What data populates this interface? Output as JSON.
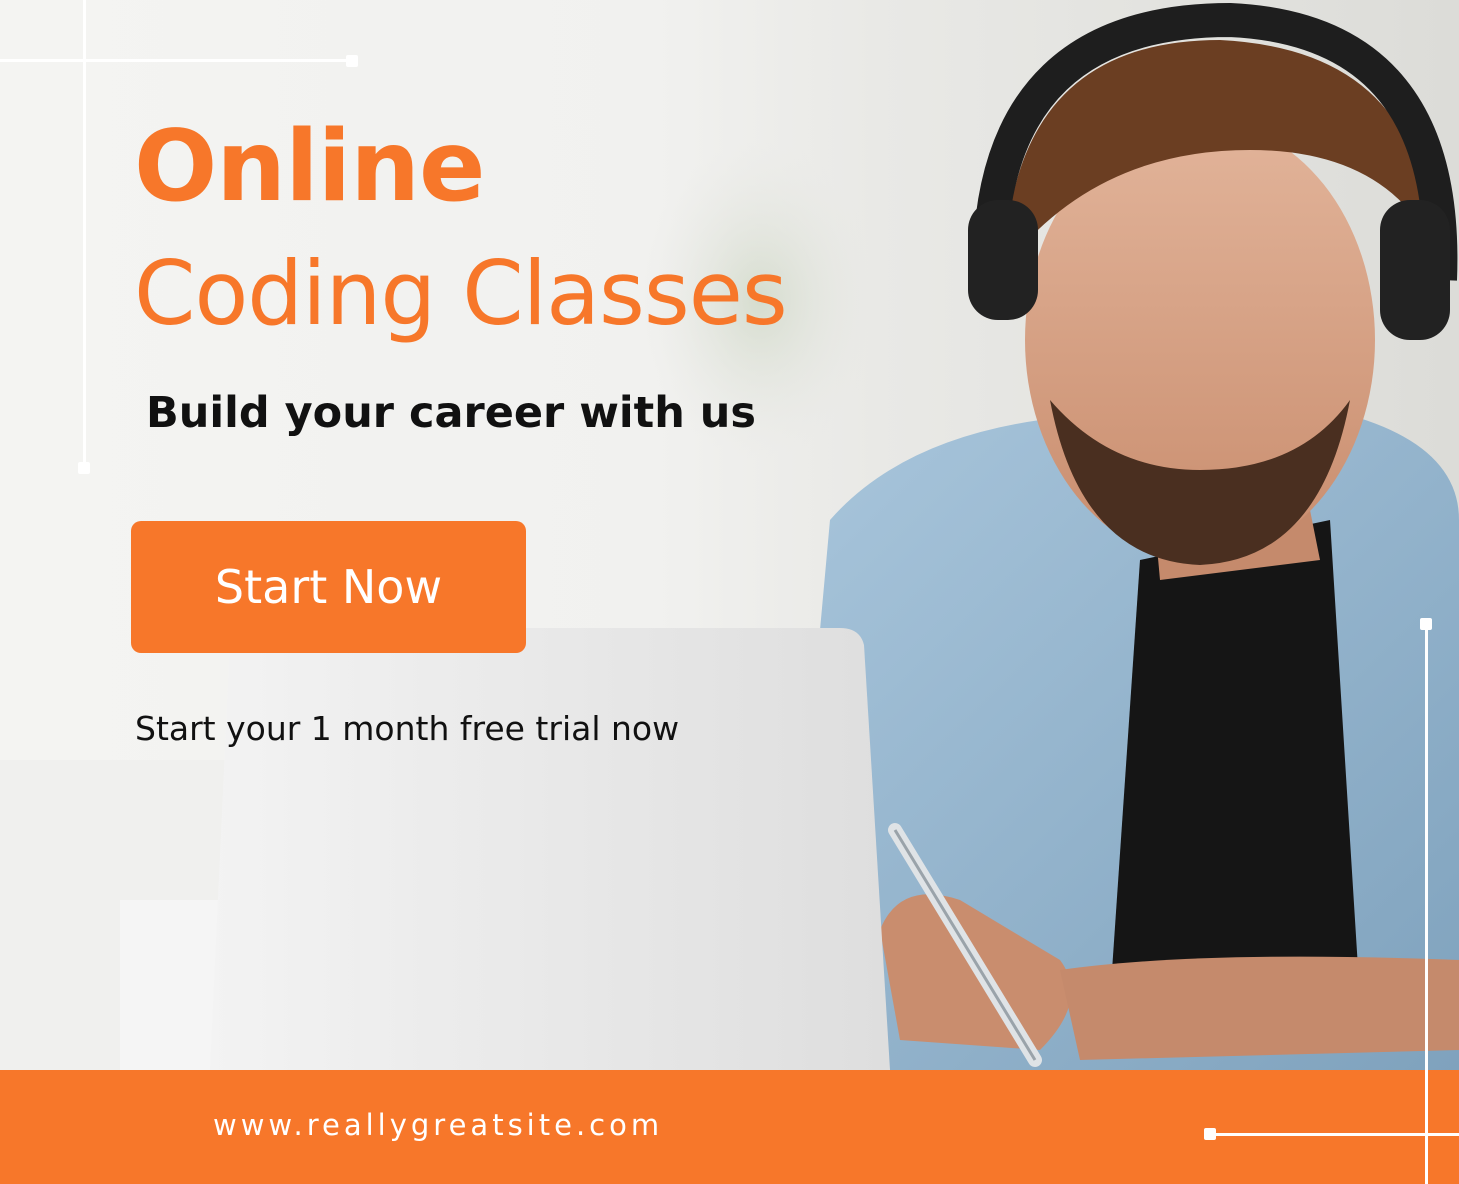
{
  "headline": {
    "line1": "Online",
    "line2": "Coding Classes"
  },
  "subheadline": "Build your career with us",
  "cta_label": "Start Now",
  "trial_text": "Start your 1 month free trial now",
  "footer": {
    "website": "www.reallygreatsite.com"
  },
  "colors": {
    "accent": "#f7772a",
    "text_dark": "#111111",
    "background": "#f2f2f0"
  },
  "photo": {
    "icons": [
      "person-icon",
      "headphones-icon",
      "laptop-icon",
      "pen-icon"
    ]
  }
}
